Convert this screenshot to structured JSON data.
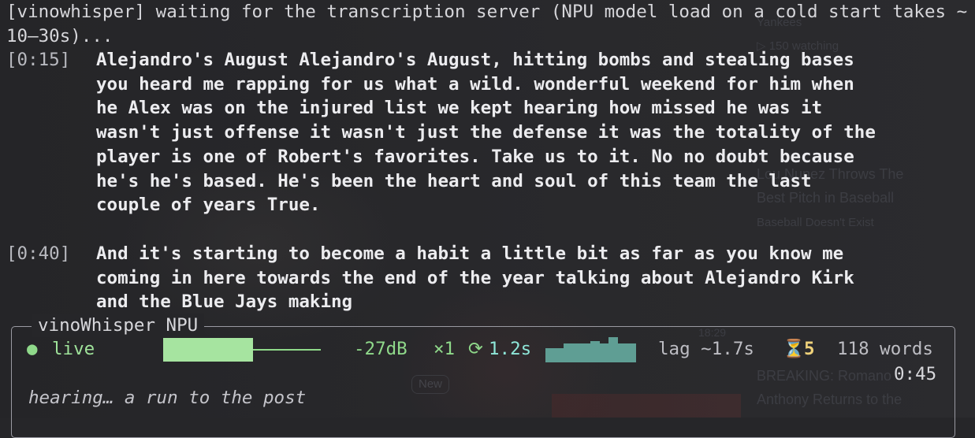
{
  "background": {
    "ghost_lines": [
      "Yankees",
      "▷ 150 watching",
      "Lou Nunez Throws The",
      "Best Pitch in Baseball",
      "Baseball Doesn't Exist",
      "BREAKING: Romano",
      "Anthony Returns to the"
    ],
    "new_badge": "New",
    "timestamp": "18:29"
  },
  "terminal": {
    "status_message": "[vinowhisper] waiting for the transcription server (NPU model load on a cold start takes ~10–30s)...",
    "segments": [
      {
        "timestamp": "[0:15]",
        "text": "Alejandro's August Alejandro's August, hitting bombs and stealing bases\nyou heard me rapping for us what a wild. wonderful weekend for him when\nhe Alex was on the injured list we kept hearing how missed he was it\nwasn't just offense it wasn't just the defense it was the totality of the\nplayer is one of Robert's favorites. Take us to it. No no doubt because\nhe's he's based. He's been the heart and soul of this team the last\ncouple of years True."
      },
      {
        "timestamp": "[0:40]",
        "text": "And it's starting to become a habit a little bit as far as you know me\ncoming in here towards the end of the year talking about Alejandro Kirk\nand the Blue Jays making"
      }
    ]
  },
  "panel": {
    "title": "vinoWhisper NPU",
    "live_dot": "●",
    "live_label": "live",
    "audio_level_fraction": 0.57,
    "db": "-27dB",
    "multiplier": "×1",
    "clock_icon": "⟳",
    "chunk_time": "1.2s",
    "throughput_history": [
      0.55,
      0.55,
      0.75,
      0.75,
      0.75,
      0.85,
      0.75,
      1.0,
      0.75,
      0.75
    ],
    "lag": "lag ~1.7s",
    "hourglass_icon": "⏳",
    "pending": "5",
    "words": "118 words",
    "elapsed": "0:45",
    "partial": "hearing… a run to the post"
  },
  "colors": {
    "background": "#262629",
    "accent_green": "#8fd98a",
    "level_fill": "#a6e4a0",
    "spark": "#5f9e94",
    "pending": "#f0d27a"
  }
}
